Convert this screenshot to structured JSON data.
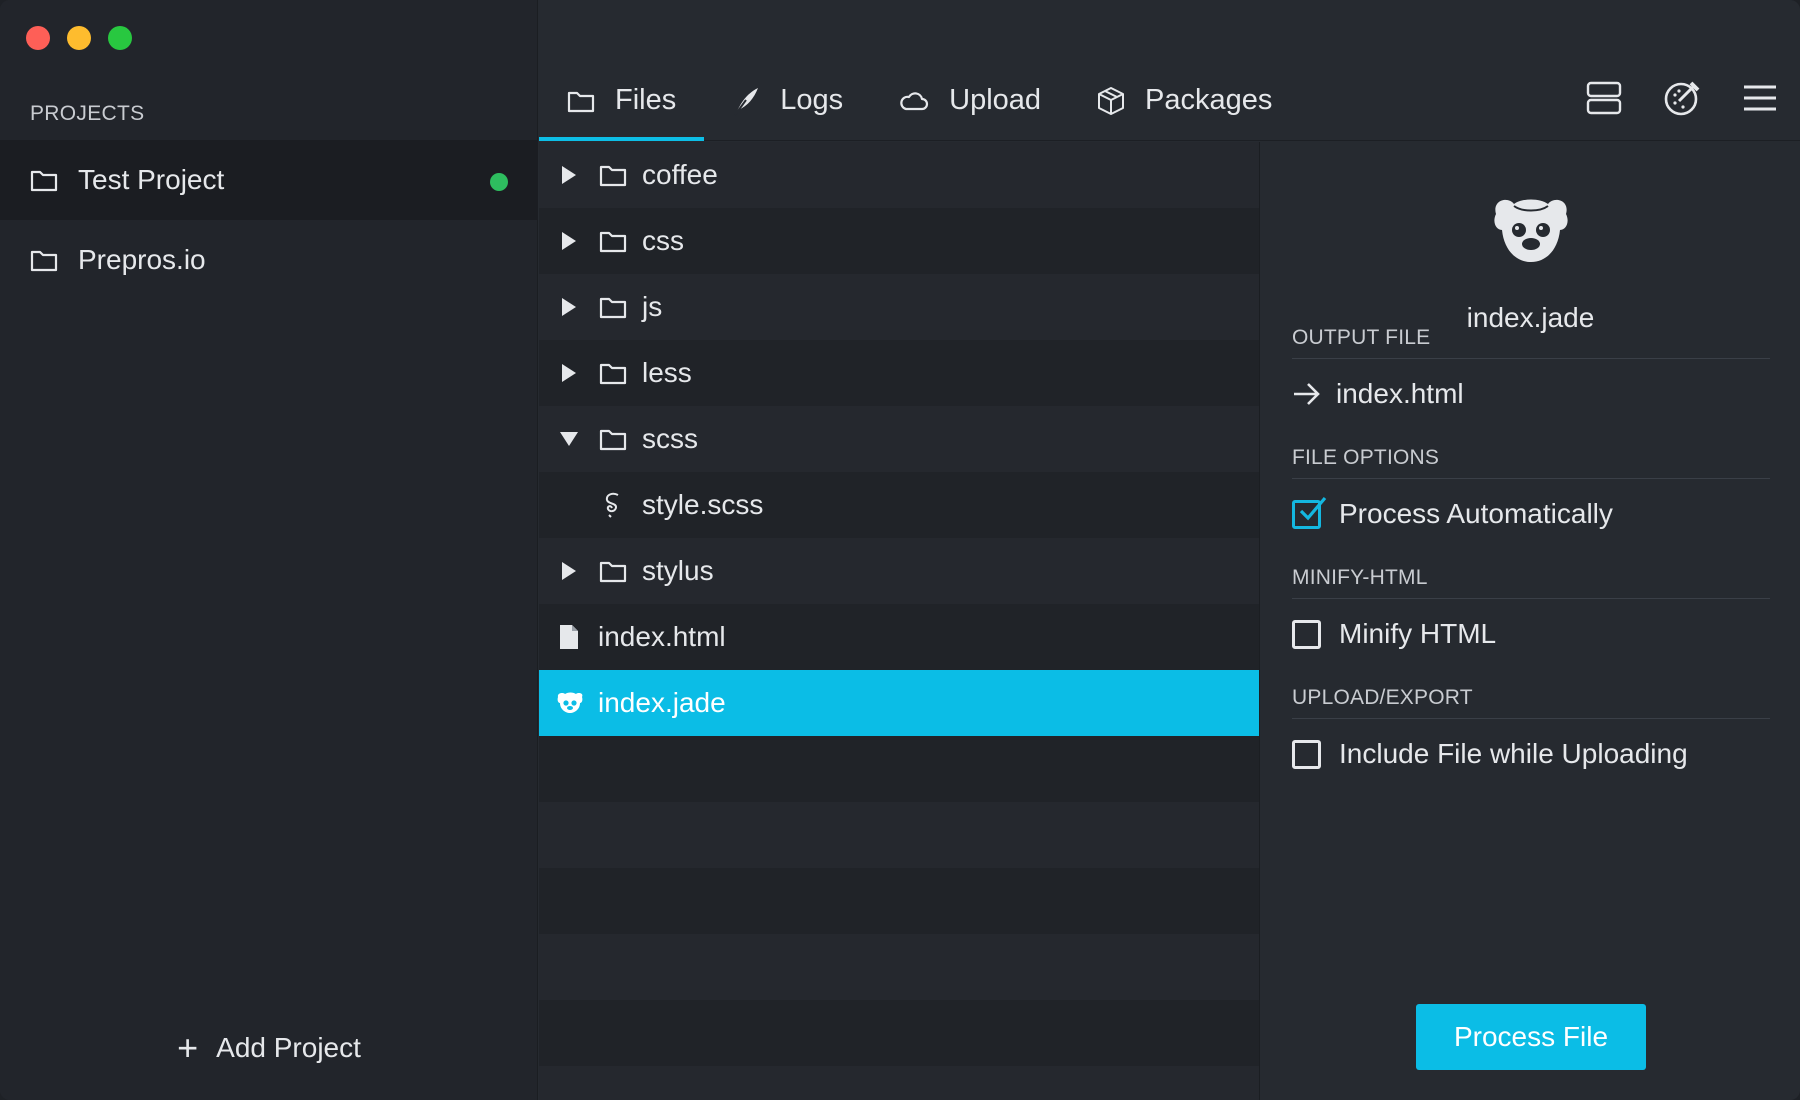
{
  "window": {
    "controls": [
      "close",
      "minimize",
      "maximize"
    ]
  },
  "sidebar": {
    "heading": "PROJECTS",
    "projects": [
      {
        "name": "Test Project",
        "active": true,
        "status": "online"
      },
      {
        "name": "Prepros.io",
        "active": false
      }
    ],
    "add_label": "Add Project"
  },
  "tabs": [
    {
      "label": "Files",
      "icon": "folder-icon",
      "active": true
    },
    {
      "label": "Logs",
      "icon": "feather-icon",
      "active": false
    },
    {
      "label": "Upload",
      "icon": "cloud-icon",
      "active": false
    },
    {
      "label": "Packages",
      "icon": "package-icon",
      "active": false
    }
  ],
  "top_actions": [
    "server-icon",
    "color-picker-icon",
    "menu-icon"
  ],
  "tree": {
    "items": [
      {
        "name": "coffee",
        "type": "folder",
        "expanded": false
      },
      {
        "name": "css",
        "type": "folder",
        "expanded": false
      },
      {
        "name": "js",
        "type": "folder",
        "expanded": false
      },
      {
        "name": "less",
        "type": "folder",
        "expanded": false
      },
      {
        "name": "scss",
        "type": "folder",
        "expanded": true
      },
      {
        "name": "style.scss",
        "type": "sass-file"
      },
      {
        "name": "stylus",
        "type": "folder",
        "expanded": false
      },
      {
        "name": "index.html",
        "type": "file"
      },
      {
        "name": "index.jade",
        "type": "pug-file",
        "selected": true
      }
    ]
  },
  "details": {
    "file_name": "index.jade",
    "output_heading": "OUTPUT FILE",
    "output_file": "index.html",
    "options_heading": "FILE OPTIONS",
    "process_auto_label": "Process Automatically",
    "process_auto_checked": true,
    "minify_heading": "MINIFY-HTML",
    "minify_label": "Minify HTML",
    "minify_checked": false,
    "upload_heading": "UPLOAD/EXPORT",
    "upload_label": "Include File while Uploading",
    "upload_checked": false,
    "process_button": "Process File"
  },
  "colors": {
    "accent": "#0bbde6",
    "status_online": "#2ebd5f",
    "sidebar_bg": "#22252b",
    "panel_bg": "#262a30"
  }
}
